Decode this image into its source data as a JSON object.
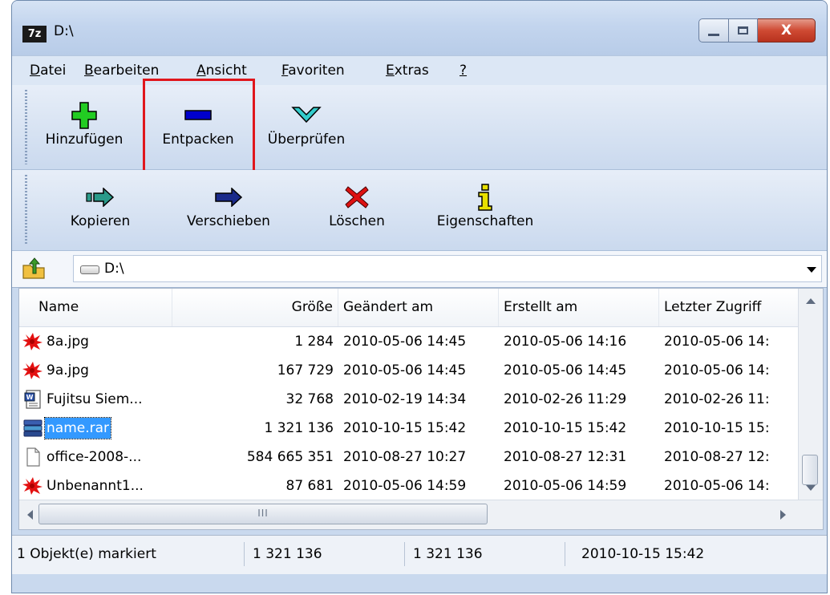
{
  "window": {
    "app_icon": "7z",
    "title": "D:\\",
    "close_glyph": "X"
  },
  "menu": [
    {
      "label": "Datei",
      "key": "D",
      "rest": "atei"
    },
    {
      "label": "Bearbeiten",
      "key": "B",
      "rest": "earbeiten"
    },
    {
      "label": "Ansicht",
      "key": "A",
      "rest": "nsicht"
    },
    {
      "label": "Favoriten",
      "key": "F",
      "rest": "avoriten"
    },
    {
      "label": "Extras",
      "key": "E",
      "rest": "xtras"
    },
    {
      "label": "?",
      "key": "?",
      "rest": ""
    }
  ],
  "toolbar1": {
    "add": {
      "label": "Hinzufügen",
      "icon": "plus-icon",
      "color": "#22cc22"
    },
    "extract": {
      "label": "Entpacken",
      "icon": "minus-icon",
      "color": "#0000cc"
    },
    "test": {
      "label": "Überprüfen",
      "icon": "checkmark-icon",
      "color": "#33cccc"
    }
  },
  "toolbar2": {
    "copy": {
      "label": "Kopieren",
      "icon": "copy-arrow-icon",
      "color": "#2a9a8a"
    },
    "move": {
      "label": "Verschieben",
      "icon": "move-arrow-icon",
      "color": "#1a2a8a"
    },
    "delete": {
      "label": "Löschen",
      "icon": "delete-x-icon",
      "color": "#dd1111"
    },
    "info": {
      "label": "Eigenschaften",
      "icon": "info-icon",
      "color": "#e8e000"
    }
  },
  "address": {
    "path": "D:\\"
  },
  "columns": [
    "Name",
    "Größe",
    "Geändert am",
    "Erstellt am",
    "Letzter Zugriff"
  ],
  "files": [
    {
      "name": "8a.jpg",
      "size": "1 284",
      "modified": "2010-05-06 14:45",
      "created": "2010-05-06 14:16",
      "accessed": "2010-05-06 14:",
      "icon": "image-file-icon",
      "selected": false
    },
    {
      "name": "9a.jpg",
      "size": "167 729",
      "modified": "2010-05-06 14:45",
      "created": "2010-05-06 14:45",
      "accessed": "2010-05-06 14:",
      "icon": "image-file-icon",
      "selected": false
    },
    {
      "name": "Fujitsu Siem...",
      "size": "32 768",
      "modified": "2010-02-19 14:34",
      "created": "2010-02-26 11:29",
      "accessed": "2010-02-26 11:",
      "icon": "word-doc-icon",
      "selected": false
    },
    {
      "name": "name.rar",
      "size": "1 321 136",
      "modified": "2010-10-15 15:42",
      "created": "2010-10-15 15:42",
      "accessed": "2010-10-15 15:",
      "icon": "rar-archive-icon",
      "selected": true
    },
    {
      "name": "office-2008-...",
      "size": "584 665 351",
      "modified": "2010-08-27 10:27",
      "created": "2010-08-27 12:31",
      "accessed": "2010-08-27 12:",
      "icon": "blank-file-icon",
      "selected": false
    },
    {
      "name": "Unbenannt1...",
      "size": "87 681",
      "modified": "2010-05-06 14:59",
      "created": "2010-05-06 14:59",
      "accessed": "2010-05-06 14:",
      "icon": "image-file-icon",
      "selected": false
    }
  ],
  "hscroll_grip": "III",
  "status": {
    "selection": "1 Objekt(e) markiert",
    "size": "1 321 136",
    "packed": "1 321 136",
    "date": "2010-10-15 15:42"
  }
}
